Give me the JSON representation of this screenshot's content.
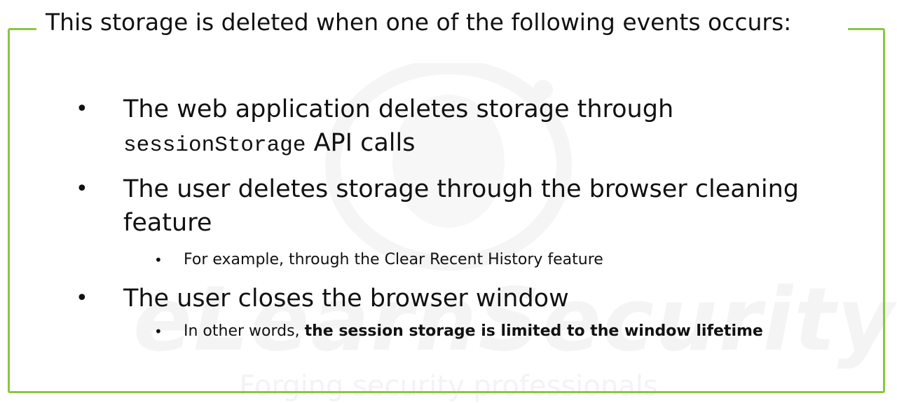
{
  "watermark": {
    "brand": "eLearnSecurity",
    "tagline": "Forging security professionals"
  },
  "colors": {
    "frame": "#8cc63f",
    "text": "#111111",
    "watermark": "#f2f2f2"
  },
  "intro": "This storage is deleted when one of the following events occurs:",
  "bullets": [
    {
      "code": "sessionStorage",
      "prefix": "The web application deletes storage through",
      "suffix": "API calls"
    },
    {
      "text": "The user deletes storage through the browser cleaning feature",
      "sub": "For example, through the Clear Recent History feature"
    },
    {
      "text": "The user closes the browser window",
      "sub_prefix": "In other words,",
      "sub_bold": "the session storage is limited to the window lifetime"
    }
  ]
}
